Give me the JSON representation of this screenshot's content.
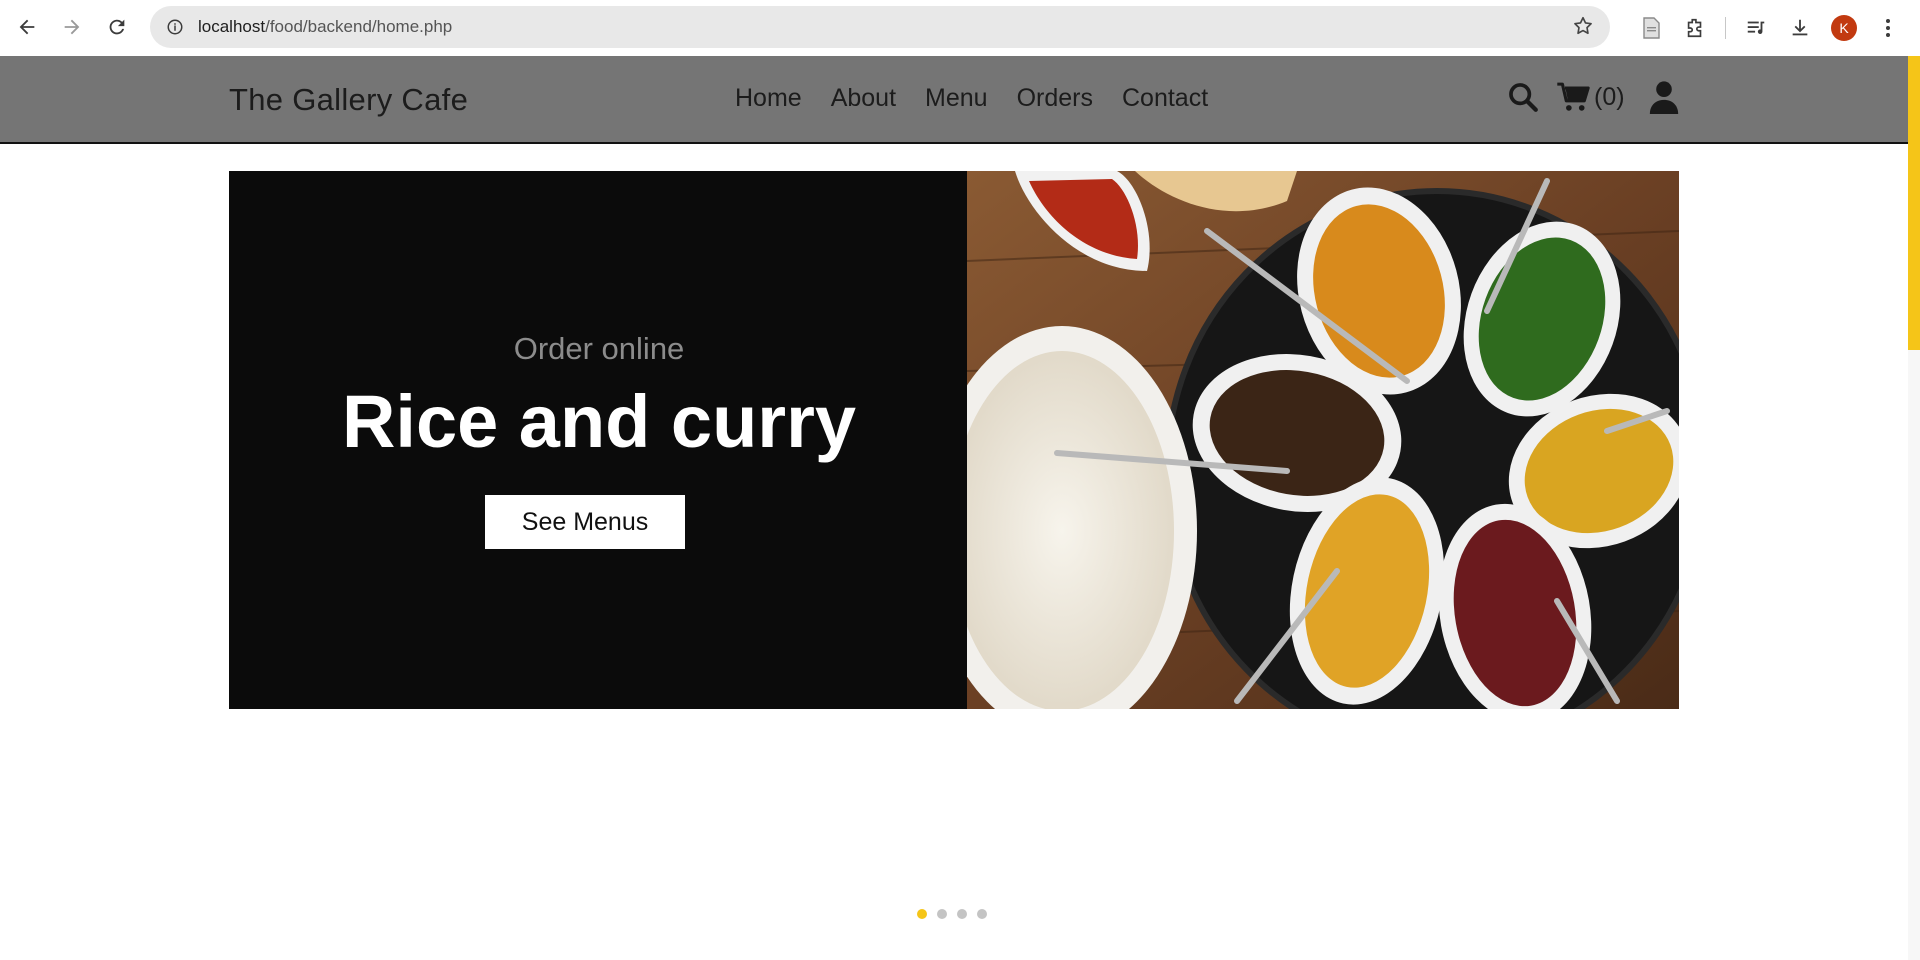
{
  "browser": {
    "url_host": "localhost",
    "url_path": "/food/backend/home.php",
    "profile_initial": "K"
  },
  "site": {
    "brand": "The Gallery Cafe",
    "nav": [
      "Home",
      "About",
      "Menu",
      "Orders",
      "Contact"
    ],
    "cart_count": "(0)"
  },
  "hero": {
    "eyebrow": "Order online",
    "headline": "Rice and curry",
    "cta_label": "See Menus",
    "image_alt": "rice-and-curry-platter"
  },
  "carousel": {
    "slide_count": 4,
    "active_index": 0
  },
  "colors": {
    "accent": "#f5c518",
    "header_bg": "#757575",
    "hero_bg": "#0b0b0b"
  }
}
